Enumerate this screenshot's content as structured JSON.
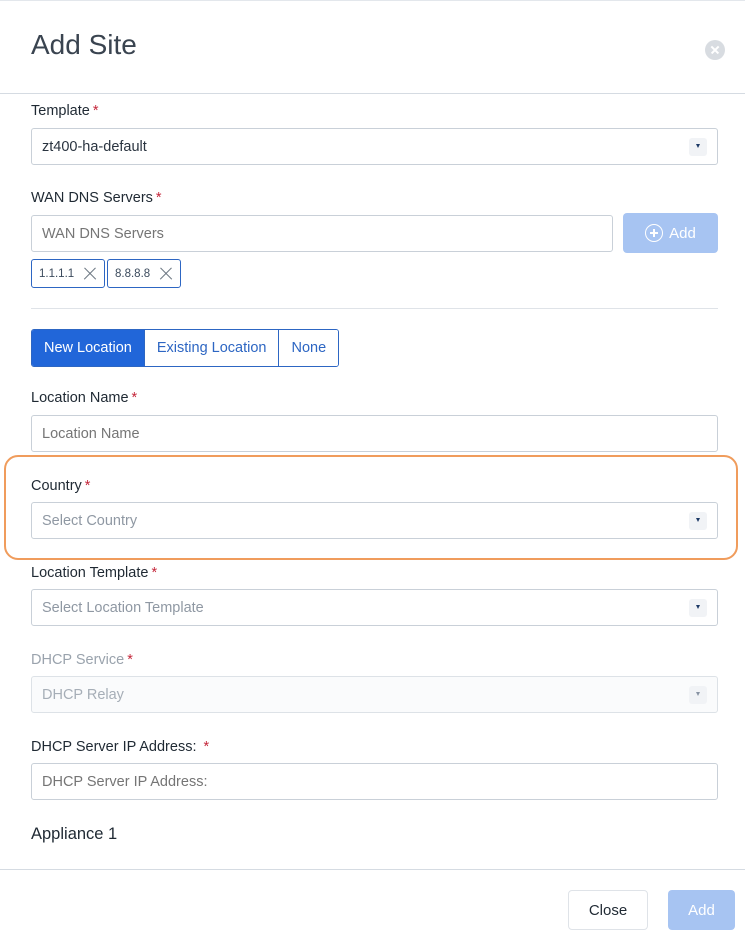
{
  "modal": {
    "title": "Add Site"
  },
  "form": {
    "template": {
      "label": "Template",
      "value": "zt400-ha-default"
    },
    "wan_dns": {
      "label": "WAN DNS Servers",
      "placeholder": "WAN DNS Servers",
      "add_label": "Add",
      "chips": [
        "1.1.1.1",
        "8.8.8.8"
      ]
    },
    "location_mode": {
      "options": [
        "New Location",
        "Existing Location",
        "None"
      ],
      "selected": "New Location"
    },
    "location_name": {
      "label": "Location Name",
      "placeholder": "Location Name"
    },
    "country": {
      "label": "Country",
      "placeholder": "Select Country"
    },
    "location_template": {
      "label": "Location Template",
      "placeholder": "Select Location Template"
    },
    "dhcp_service": {
      "label": "DHCP Service",
      "value": "DHCP Relay"
    },
    "dhcp_server_ip": {
      "label": "DHCP Server IP Address: ",
      "placeholder": "DHCP Server IP Address:"
    },
    "appliance_section": "Appliance 1"
  },
  "footer": {
    "close_label": "Close",
    "add_label": "Add"
  },
  "colors": {
    "primary": "#2166d9",
    "primary_disabled": "#a7c4f2",
    "required": "#c4263a",
    "highlight": "#f09c5c"
  },
  "icons": {
    "close": "close-circle-icon",
    "dropdown": "chevron-down-icon",
    "add": "plus-circle-icon",
    "remove_chip": "close-icon"
  }
}
